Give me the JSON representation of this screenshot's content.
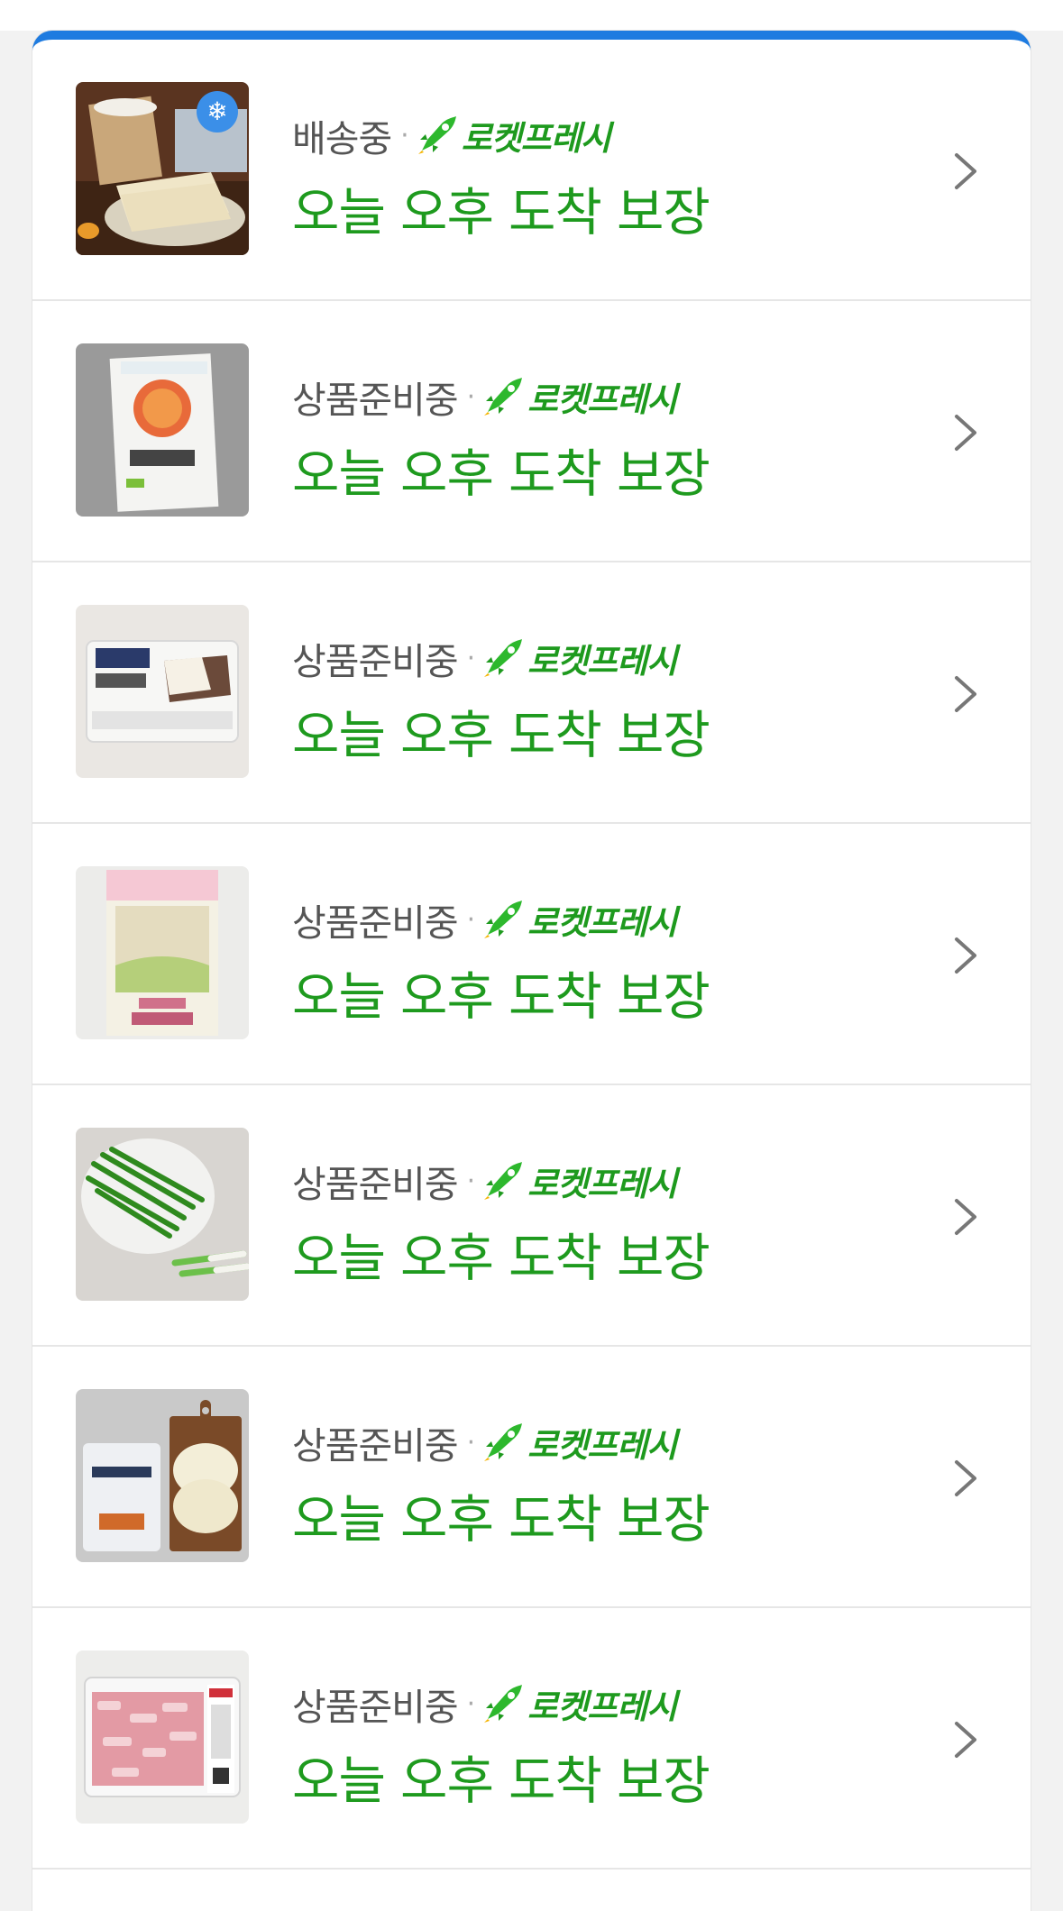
{
  "colors": {
    "accent_bar": "#1e7be0",
    "rocket_green": "#1e9a1e",
    "status_gray": "#555555"
  },
  "items": [
    {
      "status": "배송중",
      "service": "로켓프레시",
      "eta": "오늘 오후 도착 보장",
      "thumb": "dumpling-wrappers",
      "badge_icon": "snowflake-icon"
    },
    {
      "status": "상품준비중",
      "service": "로켓프레시",
      "eta": "오늘 오후 도착 보장",
      "thumb": "noodle-pack"
    },
    {
      "status": "상품준비중",
      "service": "로켓프레시",
      "eta": "오늘 오후 도착 보장",
      "thumb": "tofu-pack"
    },
    {
      "status": "상품준비중",
      "service": "로켓프레시",
      "eta": "오늘 오후 도착 보장",
      "thumb": "bean-sprouts-bag"
    },
    {
      "status": "상품준비중",
      "service": "로켓프레시",
      "eta": "오늘 오후 도착 보장",
      "thumb": "chives-plate"
    },
    {
      "status": "상품준비중",
      "service": "로켓프레시",
      "eta": "오늘 오후 도착 보장",
      "thumb": "dumpling-skins-board"
    },
    {
      "status": "상품준비중",
      "service": "로켓프레시",
      "eta": "오늘 오후 도착 보장",
      "thumb": "pork-tray"
    }
  ]
}
